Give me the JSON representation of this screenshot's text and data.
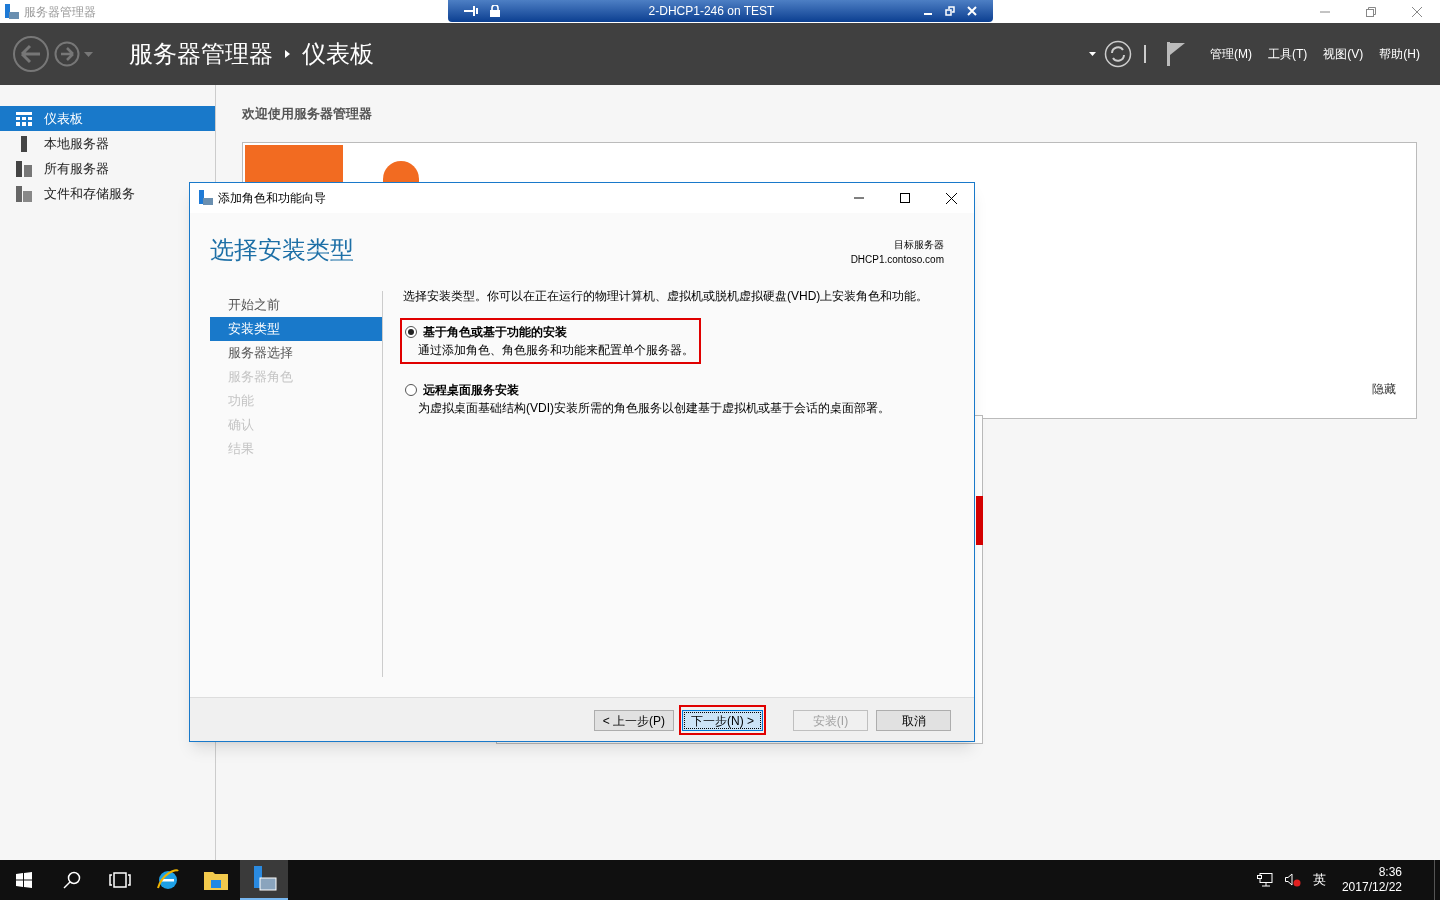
{
  "window": {
    "title": "服务器管理器"
  },
  "rdp_bar": {
    "title": "2-DHCP1-246 on TEST"
  },
  "header": {
    "breadcrumb": [
      "服务器管理器",
      "仪表板"
    ],
    "menus": [
      "管理(M)",
      "工具(T)",
      "视图(V)",
      "帮助(H)"
    ]
  },
  "sidebar": {
    "items": [
      {
        "label": "仪表板",
        "selected": true,
        "kind": "dashboard"
      },
      {
        "label": "本地服务器",
        "selected": false,
        "kind": "server"
      },
      {
        "label": "所有服务器",
        "selected": false,
        "kind": "servers"
      },
      {
        "label": "文件和存储服务",
        "selected": false,
        "kind": "storage"
      }
    ]
  },
  "content": {
    "welcome": "欢迎使用服务器管理器",
    "hide_link": "隐藏"
  },
  "dialog": {
    "title": "添加角色和功能向导",
    "heading": "选择安装类型",
    "target_label": "目标服务器",
    "target_server": "DHCP1.contoso.com",
    "steps": [
      {
        "label": "开始之前",
        "selected": false,
        "disabled": false
      },
      {
        "label": "安装类型",
        "selected": true,
        "disabled": false
      },
      {
        "label": "服务器选择",
        "selected": false,
        "disabled": false
      },
      {
        "label": "服务器角色",
        "selected": false,
        "disabled": true
      },
      {
        "label": "功能",
        "selected": false,
        "disabled": true
      },
      {
        "label": "确认",
        "selected": false,
        "disabled": true
      },
      {
        "label": "结果",
        "selected": false,
        "disabled": true
      }
    ],
    "intro": "选择安装类型。你可以在正在运行的物理计算机、虚拟机或脱机虚拟硬盘(VHD)上安装角色和功能。",
    "options": [
      {
        "title": "基于角色或基于功能的安装",
        "description": "通过添加角色、角色服务和功能来配置单个服务器。",
        "selected": true
      },
      {
        "title": "远程桌面服务安装",
        "description": "为虚拟桌面基础结构(VDI)安装所需的角色服务以创建基于虚拟机或基于会话的桌面部署。",
        "selected": false
      }
    ],
    "buttons": [
      {
        "label": "< 上一步(P)",
        "disabled": false,
        "focused": false
      },
      {
        "label": "下一步(N) >",
        "disabled": false,
        "focused": true
      },
      {
        "label": "安装(I)",
        "disabled": true,
        "focused": false
      },
      {
        "label": "取消",
        "disabled": false,
        "focused": false
      }
    ]
  },
  "taskbar": {
    "tray_language": "英",
    "time": "8:36",
    "date": "2017/12/22"
  }
}
